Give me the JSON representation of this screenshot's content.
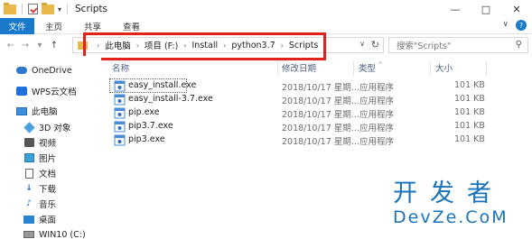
{
  "window": {
    "title": "Scripts",
    "controls": [
      "—",
      "□",
      "✕"
    ]
  },
  "ribbon": {
    "tabs": [
      "文件",
      "主页",
      "共享",
      "查看"
    ],
    "right": [
      "∨",
      "?"
    ]
  },
  "address": {
    "crumbs": [
      "此电脑",
      "项目 (F:)",
      "Install",
      "python3.7",
      "Scripts"
    ],
    "search_placeholder": "搜索\"Scripts\""
  },
  "sidebar": {
    "items": [
      {
        "label": "OneDrive",
        "icon": "onedrive-icon"
      },
      {
        "label": "WPS云文档",
        "icon": "wps-cloud-icon"
      },
      {
        "label": "此电脑",
        "icon": "this-pc-icon"
      },
      {
        "label": "3D 对象",
        "icon": "3d-objects-icon"
      },
      {
        "label": "视频",
        "icon": "video-icon"
      },
      {
        "label": "图片",
        "icon": "pictures-icon"
      },
      {
        "label": "文档",
        "icon": "documents-icon"
      },
      {
        "label": "下载",
        "icon": "download-icon"
      },
      {
        "label": "音乐",
        "icon": "music-icon"
      },
      {
        "label": "桌面",
        "icon": "desktop-icon"
      },
      {
        "label": "WIN10 (C:)",
        "icon": "drive-icon"
      }
    ]
  },
  "columns": [
    "名称",
    "修改日期",
    "类型",
    "大小"
  ],
  "files": [
    {
      "name": "easy_install.exe",
      "date": "2018/10/17 星期...",
      "type": "应用程序",
      "size": "101 KB"
    },
    {
      "name": "easy_install-3.7.exe",
      "date": "2018/10/17 星期...",
      "type": "应用程序",
      "size": "101 KB"
    },
    {
      "name": "pip.exe",
      "date": "2018/10/17 星期...",
      "type": "应用程序",
      "size": "101 KB"
    },
    {
      "name": "pip3.7.exe",
      "date": "2018/10/17 星期...",
      "type": "应用程序",
      "size": "101 KB"
    },
    {
      "name": "pip3.exe",
      "date": "2018/10/17 星期...",
      "type": "应用程序",
      "size": "101 KB"
    }
  ],
  "watermark": {
    "chinese": "开发者",
    "english": "DevZe.CoM"
  },
  "colors": {
    "file_tab": "#1979ca",
    "highlight_box": "#e0221b",
    "watermark": "#1a73b8"
  }
}
